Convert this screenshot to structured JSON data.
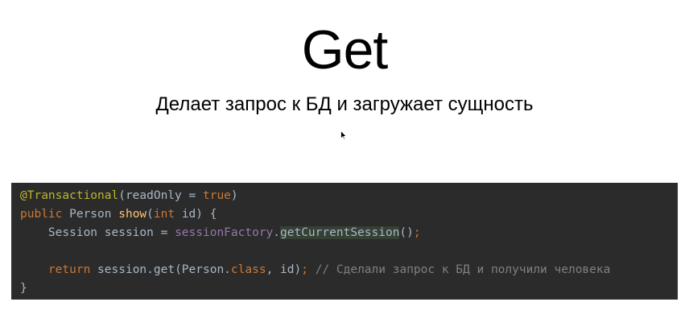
{
  "slide": {
    "title": "Get",
    "subtitle": "Делает запрос к БД и загружает сущность"
  },
  "code": {
    "line1": {
      "annotation": "@Transactional",
      "open": "(readOnly = ",
      "value": "true",
      "close": ")"
    },
    "line2": {
      "modifier": "public",
      "type": " Person ",
      "method": "show",
      "paren_open": "(",
      "param_type": "int",
      "rest": " id) {"
    },
    "line3": {
      "indent": "    ",
      "decl": "Session session = ",
      "field": "sessionFactory",
      "dot": ".",
      "call": "getCurrentSession",
      "args": "()",
      "semicolon": ";"
    },
    "line4": {
      "text": ""
    },
    "line5": {
      "indent": "    ",
      "keyword": "return",
      "expr": " session.get(Person.",
      "class_kw": "class",
      "rest": ", id)",
      "semicolon": ";",
      "comment": " // Сделали запрос к БД и получили человека"
    },
    "line6": {
      "text": "}"
    }
  },
  "colors": {
    "code_background": "#2b2b2b",
    "annotation": "#bbb529",
    "keyword": "#cc7832",
    "method": "#ffc66d",
    "field": "#9876aa",
    "comment": "#808080",
    "plain": "#a9b7c6"
  },
  "icons": {
    "cursor": "mouse-pointer-icon"
  }
}
